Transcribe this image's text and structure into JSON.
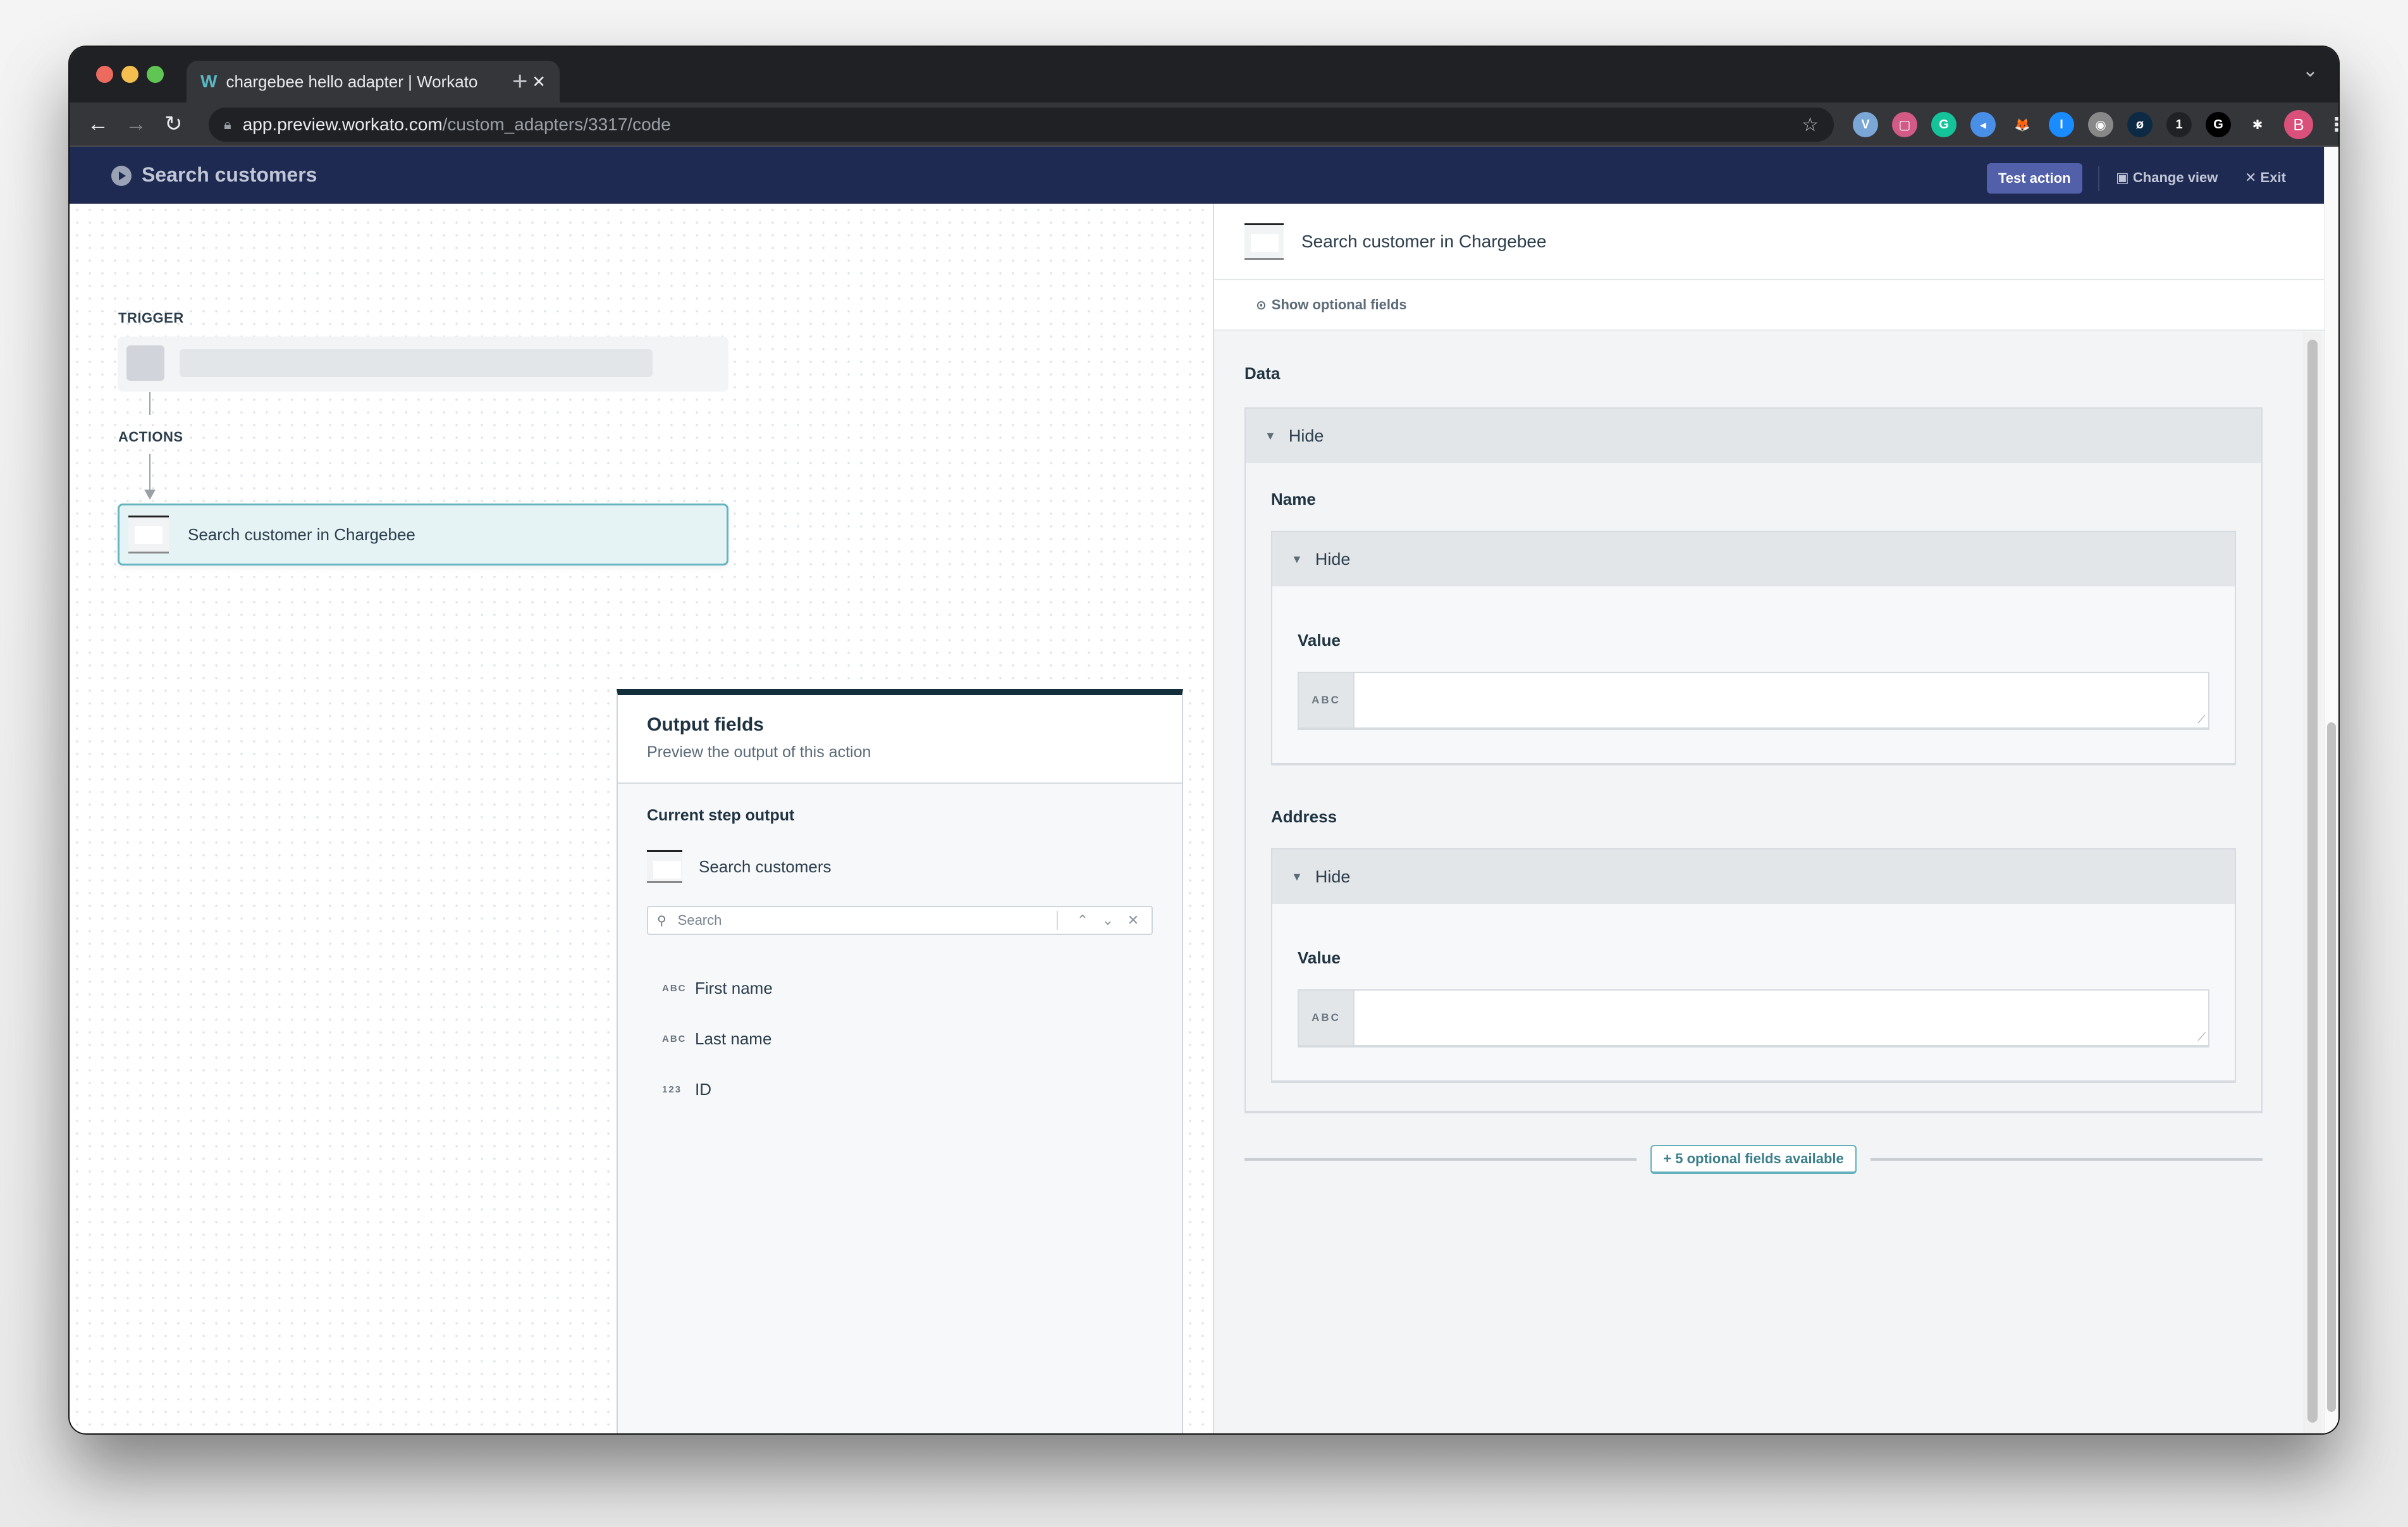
{
  "browser": {
    "tab_title": "chargebee hello adapter | Workato",
    "tab_favicon": "workato-logo",
    "new_tab_label": "+",
    "url_host": "app.preview.workato.com",
    "url_path": "/custom_adapters/3317/code",
    "profile_initial": "B",
    "extensions": [
      {
        "name": "vimeo-extension",
        "glyph": "V",
        "color": "#7ba7d6"
      },
      {
        "name": "screen-recorder-extension",
        "glyph": "▢",
        "color": "#d15b85"
      },
      {
        "name": "grammarly-extension",
        "glyph": "G",
        "color": "#15c39a"
      },
      {
        "name": "tag-extension",
        "glyph": "◂",
        "color": "#4a8fe7"
      },
      {
        "name": "metamask-extension",
        "glyph": "🦊",
        "color": "#35363a"
      },
      {
        "name": "1password-extension",
        "glyph": "I",
        "color": "#1a8cff"
      },
      {
        "name": "camera-extension",
        "glyph": "◉",
        "color": "#888888"
      },
      {
        "name": "planet-extension",
        "glyph": "ø",
        "color": "#0c2a44"
      },
      {
        "name": "one-extension",
        "glyph": "1",
        "color": "#202124"
      },
      {
        "name": "g-extension",
        "glyph": "G",
        "color": "#000000"
      },
      {
        "name": "puzzle-extension",
        "glyph": "✱",
        "color": "#35363a"
      }
    ]
  },
  "header": {
    "title": "Search customers",
    "test_action_label": "Test action",
    "change_view_label": "Change view",
    "exit_label": "Exit"
  },
  "canvas": {
    "trigger_label": "TRIGGER",
    "actions_label": "ACTIONS",
    "action_step_label": "Search customer in Chargebee"
  },
  "output_panel": {
    "title": "Output fields",
    "subtitle": "Preview the output of this action",
    "current_step_label": "Current step output",
    "step_name": "Search customers",
    "search_placeholder": "Search",
    "fields": [
      {
        "type": "ABC",
        "name": "First name"
      },
      {
        "type": "ABC",
        "name": "Last name"
      },
      {
        "type": "123",
        "name": "ID"
      }
    ]
  },
  "right_panel": {
    "title": "Search customer in Chargebee",
    "show_optional_label": "Show optional fields",
    "data_label": "Data",
    "hide_label": "Hide",
    "groups": [
      {
        "label": "Name",
        "hide_label": "Hide",
        "value_label": "Value",
        "type_badge": "ABC",
        "value": ""
      },
      {
        "label": "Address",
        "hide_label": "Hide",
        "value_label": "Value",
        "type_badge": "ABC",
        "value": ""
      }
    ],
    "optional_fields_label": "+ 5 optional fields available"
  },
  "colors": {
    "header_bg": "#1f2a52",
    "accent_button": "#5260aa",
    "teal_accent": "#63b5bf"
  }
}
